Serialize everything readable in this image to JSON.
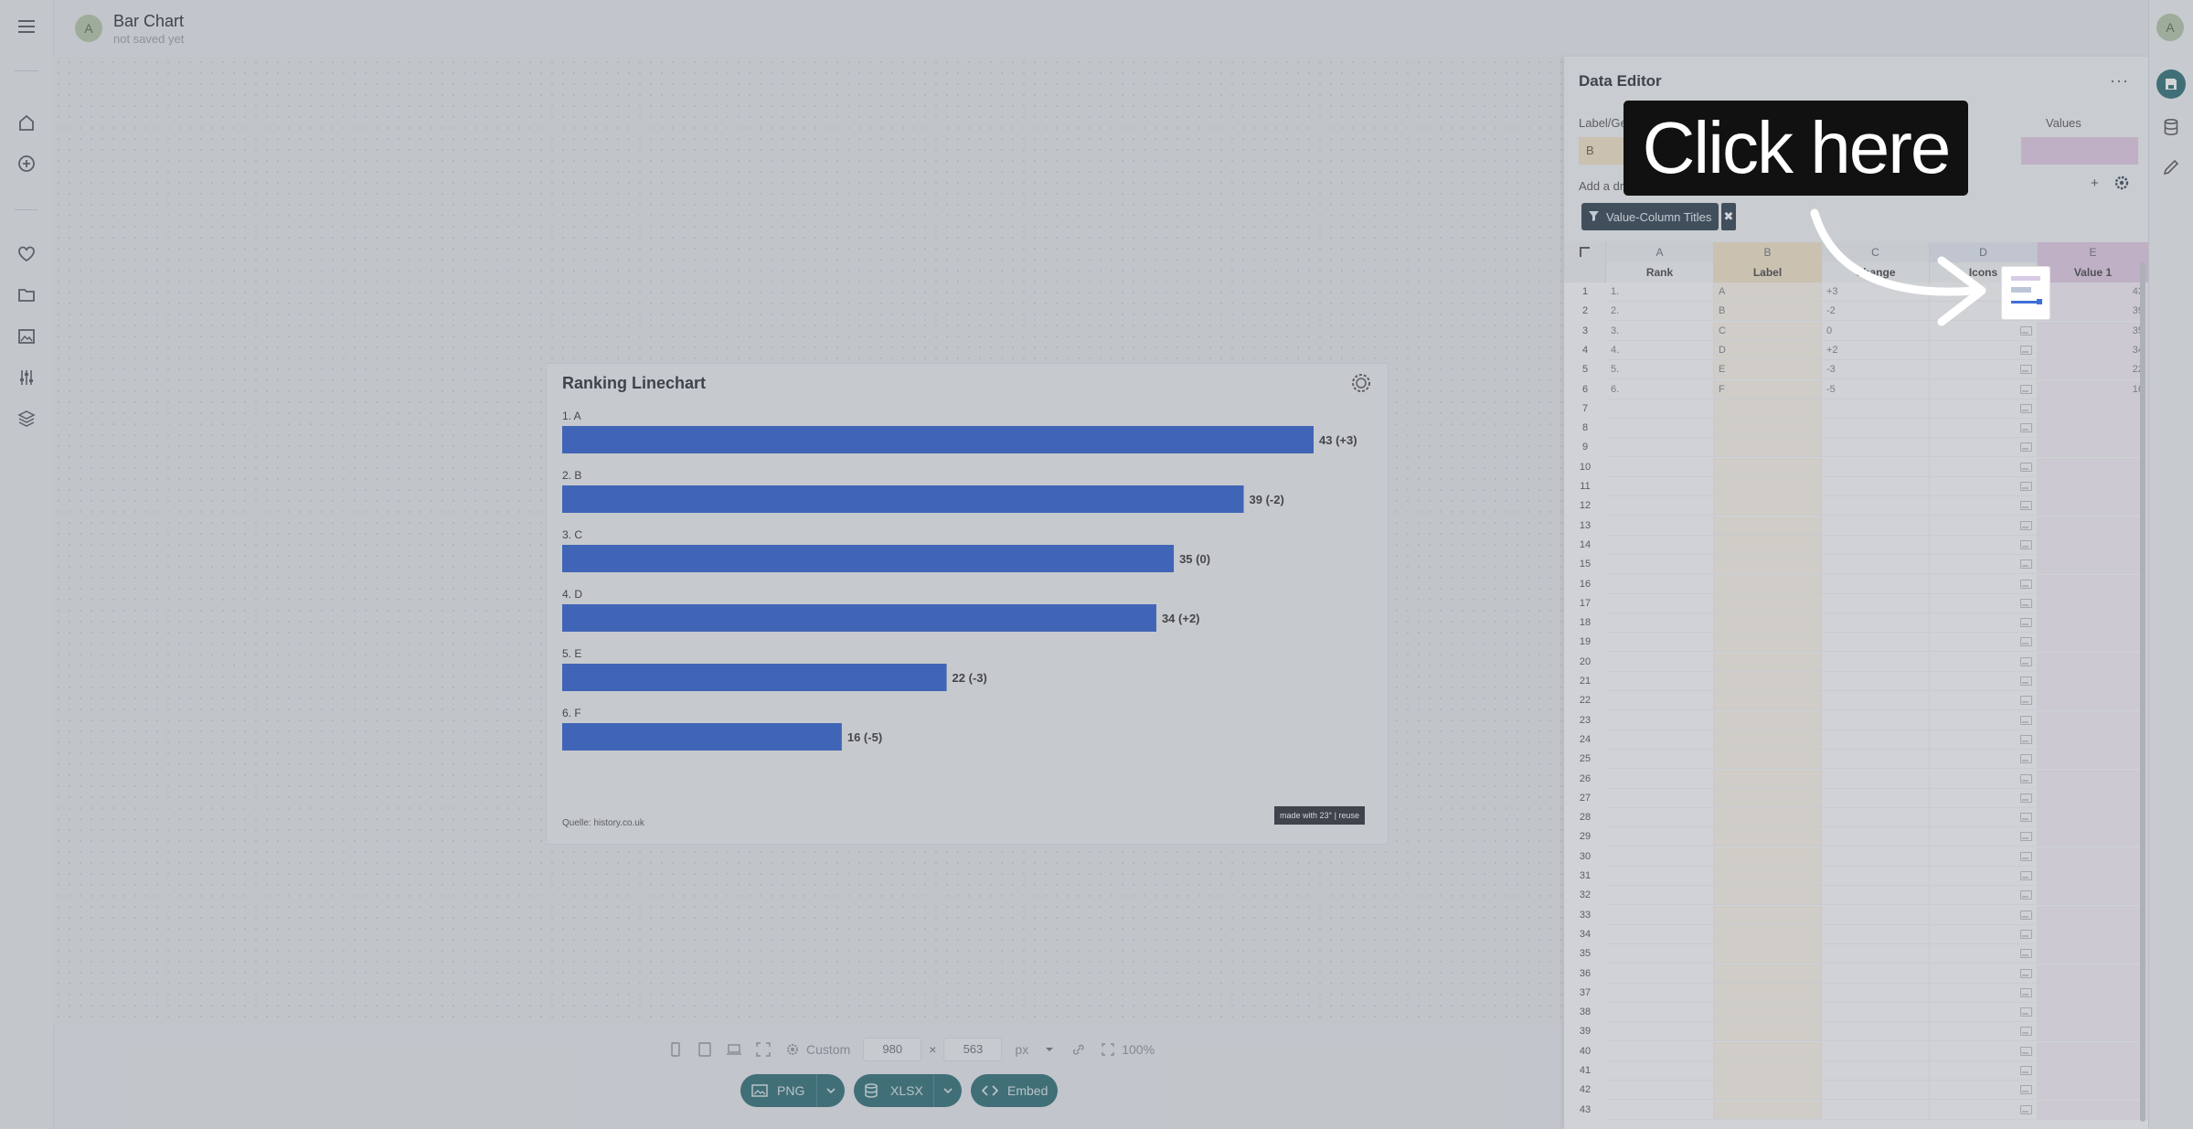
{
  "app": {
    "doc_title": "Bar Chart",
    "doc_subtitle": "not saved yet",
    "avatar_initial": "A"
  },
  "chart": {
    "title": "Ranking Linechart",
    "source": "Quelle: history.co.uk",
    "made_with": "made with 23° | reuse",
    "bar_color": "#2f5fcf"
  },
  "chart_data": {
    "type": "bar",
    "orientation": "horizontal",
    "categories": [
      "1. A",
      "2. B",
      "3. C",
      "4. D",
      "5. E",
      "6. F"
    ],
    "values": [
      43,
      39,
      35,
      34,
      22,
      16
    ],
    "value_labels": [
      "43 (+3)",
      "39 (-2)",
      "35 (0)",
      "34 (+2)",
      "22 (-3)",
      "16 (-5)"
    ],
    "title": "Ranking Linechart",
    "xlim": [
      0,
      43
    ]
  },
  "toolbar": {
    "preset": "Custom",
    "width": "980",
    "times": "×",
    "height": "563",
    "unit": "px",
    "zoom": "100%",
    "png_label": "PNG",
    "xlsx_label": "XLSX",
    "embed_label": "Embed"
  },
  "editor": {
    "title": "Data Editor",
    "label_field": "Label/Ge",
    "values_field": "Values",
    "label_value": "B",
    "dropdown_text": "Add a dropdown to the statistic",
    "filter_chip": "Value-Column Titles",
    "plus": "+",
    "more": "···",
    "chip_close": "✖"
  },
  "sheet": {
    "columns": [
      "A",
      "B",
      "C",
      "D",
      "E"
    ],
    "titles": [
      "Rank",
      "Label",
      "Change",
      "Icons",
      "Value 1"
    ],
    "rows": [
      {
        "n": "1",
        "a": "1.",
        "b": "A",
        "c": "+3",
        "e": "43"
      },
      {
        "n": "2",
        "a": "2.",
        "b": "B",
        "c": "-2",
        "e": "39"
      },
      {
        "n": "3",
        "a": "3.",
        "b": "C",
        "c": "0",
        "e": "35"
      },
      {
        "n": "4",
        "a": "4.",
        "b": "D",
        "c": "+2",
        "e": "34"
      },
      {
        "n": "5",
        "a": "5.",
        "b": "E",
        "c": "-3",
        "e": "22"
      },
      {
        "n": "6",
        "a": "6.",
        "b": "F",
        "c": "-5",
        "e": "16"
      }
    ],
    "empty_row_numbers": [
      "7",
      "8",
      "9",
      "10",
      "11",
      "12",
      "13",
      "14",
      "15",
      "16",
      "17",
      "18",
      "19",
      "20",
      "21",
      "22",
      "23",
      "24",
      "25",
      "26",
      "27",
      "28",
      "29",
      "30",
      "31",
      "32",
      "33",
      "34",
      "35",
      "36",
      "37",
      "38",
      "39",
      "40",
      "41",
      "42",
      "43"
    ]
  },
  "overlay": {
    "tooltip": "Click here"
  }
}
